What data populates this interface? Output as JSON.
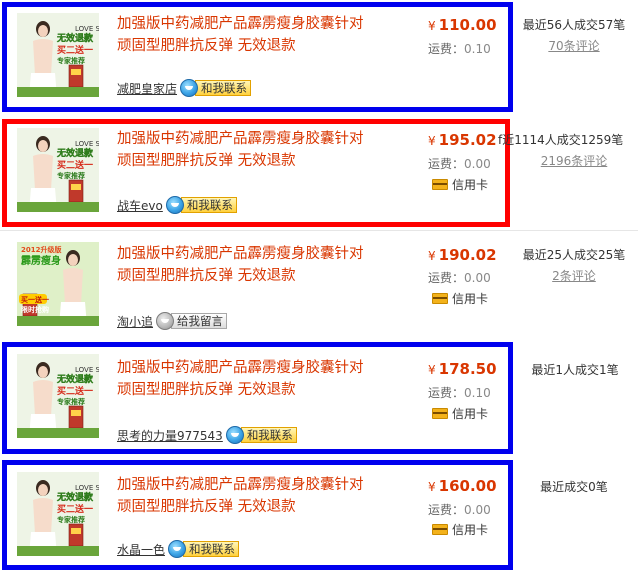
{
  "listings": [
    {
      "title_line1": "加强版中药减肥产品霹雳瘦身胶囊针对",
      "title_line2": "顽固型肥胖抗反弹 无效退款",
      "thumbnail": {
        "line1": "无效退款",
        "line2": "买二送一",
        "line3": "专家推荐",
        "brand": "LOVE SLIM"
      },
      "currency": "¥",
      "price": "110.00",
      "shipping_label": "运费：",
      "shipping_fee": "0.10",
      "payment": "",
      "seller": "减肥皇家店",
      "contact_label": "和我联系",
      "contact_online": true,
      "sales": "最近56人成交57笔",
      "reviews": "70条评论",
      "highlight_color": "#0000ee"
    },
    {
      "title_line1": "加强版中药减肥产品霹雳瘦身胶囊针对",
      "title_line2": "顽固型肥胖抗反弹 无效退款",
      "thumbnail": {
        "line1": "无效退款",
        "line2": "买二送一",
        "line3": "专家推荐",
        "brand": "LOVE SLIM"
      },
      "currency": "¥",
      "price": "195.02",
      "shipping_label": "运费：",
      "shipping_fee": "0.00",
      "payment": "信用卡",
      "seller": "战车evo",
      "contact_label": "和我联系",
      "contact_online": true,
      "sales": "f近1114人成交1259笔",
      "reviews": "2196条评论",
      "highlight_color": "#ff0000"
    },
    {
      "title_line1": "加强版中药减肥产品霹雳瘦身胶囊针对",
      "title_line2": "顽固型肥胖抗反弹 无效退款",
      "thumbnail": {
        "line1": "2012升级版",
        "line2": "霹雳瘦身",
        "line3": "限时抢购",
        "brand": "买一送一"
      },
      "currency": "¥",
      "price": "190.02",
      "shipping_label": "运费：",
      "shipping_fee": "0.00",
      "payment": "信用卡",
      "seller": "淘小追",
      "contact_label": "给我留言",
      "contact_online": false,
      "sales": "最近25人成交25笔",
      "reviews": "2条评论",
      "highlight_color": ""
    },
    {
      "title_line1": "加强版中药减肥产品霹雳瘦身胶囊针对",
      "title_line2": "顽固型肥胖抗反弹 无效退款",
      "thumbnail": {
        "line1": "无效退款",
        "line2": "买二送一",
        "line3": "专家推荐",
        "brand": "LOVE SLIM"
      },
      "currency": "¥",
      "price": "178.50",
      "shipping_label": "运费：",
      "shipping_fee": "0.10",
      "payment": "信用卡",
      "seller": "思考的力量977543",
      "contact_label": "和我联系",
      "contact_online": true,
      "sales": "最近1人成交1笔",
      "reviews": "",
      "highlight_color": "#0000ee"
    },
    {
      "title_line1": "加强版中药减肥产品霹雳瘦身胶囊针对",
      "title_line2": "顽固型肥胖抗反弹 无效退款",
      "thumbnail": {
        "line1": "无效退款",
        "line2": "买二送一",
        "line3": "专家推荐",
        "brand": "LOVE SLIM"
      },
      "currency": "¥",
      "price": "160.00",
      "shipping_label": "运费：",
      "shipping_fee": "0.00",
      "payment": "信用卡",
      "seller": "水晶一色",
      "contact_label": "和我联系",
      "contact_online": true,
      "sales": "最近成交0笔",
      "reviews": "",
      "highlight_color": "#0000ee"
    }
  ]
}
